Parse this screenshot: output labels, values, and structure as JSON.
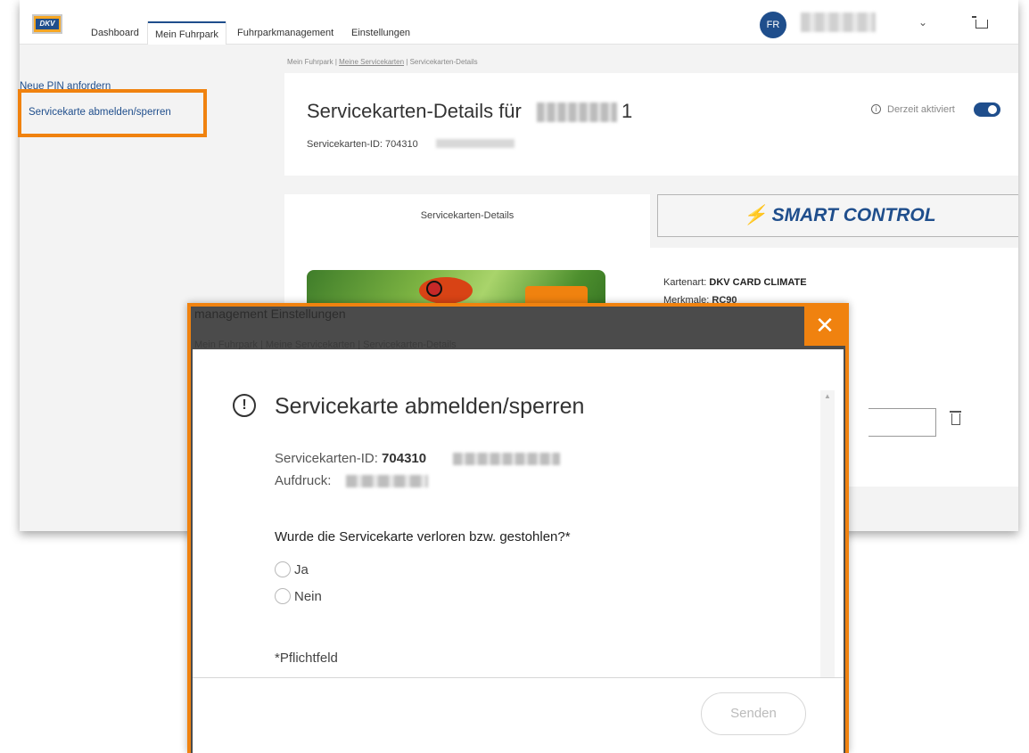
{
  "nav": {
    "logo_text": "DKV",
    "tabs": [
      "Dashboard",
      "Mein Fuhrpark",
      "Fuhrparkmanagement",
      "Einstellungen"
    ],
    "active_tab": "Mein Fuhrpark",
    "user_initials": "FR"
  },
  "sidebar": {
    "items": [
      "Neue PIN anfordern",
      "Servicekarte abmelden/sperren"
    ]
  },
  "breadcrumb": {
    "root": "Mein Fuhrpark",
    "middle": "Meine Servicekarten",
    "current": "Servicekarten-Details",
    "separator": "|"
  },
  "details": {
    "title": "Servicekarten-Details für",
    "title_suffix": "1",
    "id_label": "Servicekarten-ID: 704310",
    "status_label": "Derzeit aktiviert",
    "tab_details": "Servicekarten-Details",
    "tab_smart_control": "SMART CONTROL",
    "kartenart_label": "Kartenart:",
    "kartenart_value": "DKV CARD CLIMATE",
    "merkmale_label": "Merkmale:",
    "merkmale_value": "RC90"
  },
  "modal_ghost": {
    "nav_text": "management    Einstellungen",
    "breadcrumb_text": "Mein Fuhrpark |  Meine Servicekarten |  Servicekarten-Details"
  },
  "modal": {
    "title": "Servicekarte abmelden/sperren",
    "id_label": "Servicekarten-ID:",
    "id_value": "704310",
    "aufdruck_label": "Aufdruck:",
    "question": "Wurde die Servicekarte verloren bzw. gestohlen?*",
    "options": [
      "Ja",
      "Nein"
    ],
    "required_note": "*Pflichtfeld",
    "send_label": "Senden",
    "close_symbol": "✕"
  },
  "colors": {
    "accent_orange": "#f0820f",
    "brand_blue": "#1f4e8c"
  }
}
